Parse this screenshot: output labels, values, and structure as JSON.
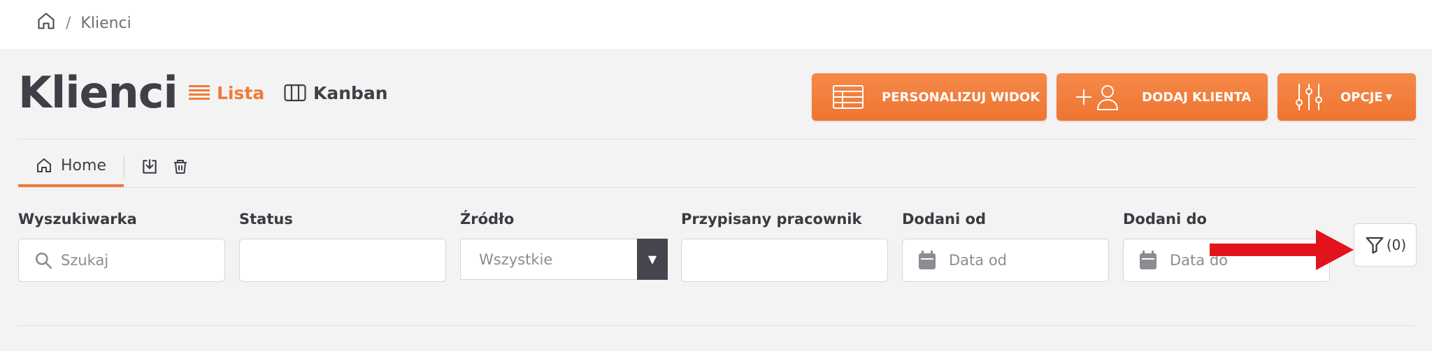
{
  "breadcrumb": {
    "separator": "/",
    "current": "Klienci"
  },
  "page": {
    "title": "Klienci"
  },
  "views": {
    "list_label": "Lista",
    "kanban_label": "Kanban"
  },
  "actions": {
    "personalize_label": "PERSONALIZUJ WIDOK",
    "add_label": "DODAJ KLIENTA",
    "options_label": "OPCJE"
  },
  "tabs": {
    "home_label": "Home"
  },
  "filters": {
    "search": {
      "label": "Wyszukiwarka",
      "placeholder": "Szukaj"
    },
    "status": {
      "label": "Status",
      "value": ""
    },
    "source": {
      "label": "Źródło",
      "value": "Wszystkie"
    },
    "employee": {
      "label": "Przypisany pracownik",
      "value": ""
    },
    "added_from": {
      "label": "Dodani od",
      "placeholder": "Data od"
    },
    "added_to": {
      "label": "Dodani do",
      "placeholder": "Data do"
    },
    "filter_count": "(0)"
  },
  "colors": {
    "accent": "#f07b38",
    "annotation_arrow": "#e3131b",
    "dark": "#3f3f48"
  },
  "icons": [
    "home-icon",
    "list-icon",
    "kanban-icon",
    "table-icon",
    "add-user-icon",
    "sliders-icon",
    "export-icon",
    "trash-icon",
    "search-icon",
    "calendar-icon",
    "filter-icon"
  ]
}
